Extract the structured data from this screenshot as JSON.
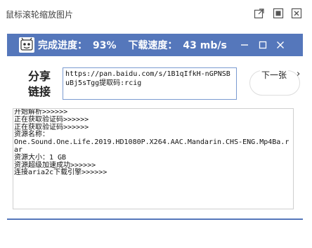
{
  "window": {
    "title": "鼠标滚轮缩放图片",
    "controls": [
      "open-external-icon",
      "restore-icon",
      "close-icon"
    ]
  },
  "progress": {
    "complete_label": "完成进度：",
    "complete_value": "93%",
    "speed_label": "下载速度：",
    "speed_value": "43 mb/s",
    "bar_color": "#5577bb",
    "window_controls": [
      "minimize-icon",
      "maximize-icon",
      "close-icon"
    ]
  },
  "share": {
    "label_line1": "分享",
    "label_line2": "链接",
    "link_value": "https://pan.baidu.com/s/1B1qIfkH-nGPNSBuBj5sTgg提取码:rcig"
  },
  "next": {
    "label": "下一张",
    "arrow": "›"
  },
  "log": {
    "lines": [
      "开始解析>>>>>>",
      "正在获取验证码>>>>>>",
      "正在获取验证码>>>>>>",
      "资源名称：",
      "One.Sound.One.Life.2019.HD1080P.X264.AAC.Mandarin.CHS-ENG.Mp4Ba.rar",
      "资源大小：1 GB",
      "资源超级加速成功>>>>>>",
      "连接aria2c下载引擎>>>>>>"
    ]
  },
  "colors": {
    "accent": "#5577bb",
    "link_border": "#7a9bd1"
  }
}
